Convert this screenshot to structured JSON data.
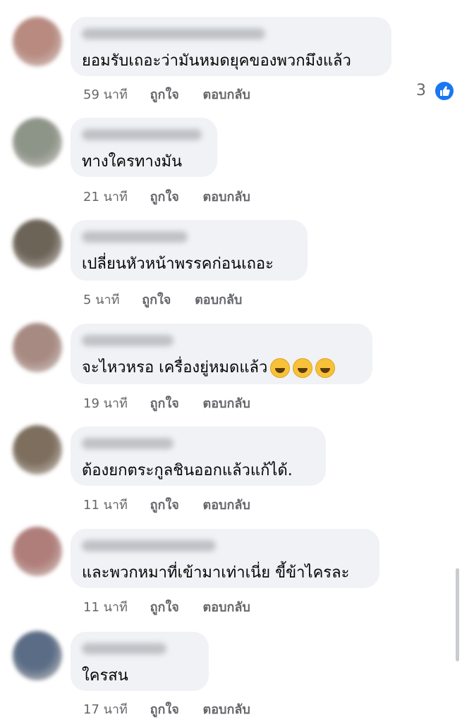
{
  "actions": {
    "like": "ถูกใจ",
    "reply": "ตอบกลับ"
  },
  "comments": [
    {
      "text": "ยอมรับเถอะว่ามันหมดยุคของพวกมึงแล้ว",
      "time": "59 นาที",
      "reaction_count": "3",
      "avatar_color": "#b88a80"
    },
    {
      "text": "ทางใครทางมัน",
      "time": "21 นาที",
      "avatar_color": "#8d9488"
    },
    {
      "text": "เปลี่ยนหัวหน้าพรรคก่อนเถอะ",
      "time": "5 นาที",
      "avatar_color": "#6d6458"
    },
    {
      "text": "จะไหวหรอ เครื่องยู่หมดแล้ว",
      "time": "19 นาที",
      "emojis": [
        "rofl-emoji",
        "rofl-emoji",
        "rofl-emoji"
      ],
      "avatar_color": "#a78a82"
    },
    {
      "text": "ต้องยกตระกูลชินออกแล้วแก้ได้.",
      "time": "11 นาที",
      "avatar_color": "#7d6e5e"
    },
    {
      "text": "และพวกหมาที่เข้ามาเท่าเนี่ย ขี้ข้าไครละ",
      "time": "11 นาที",
      "avatar_color": "#b07e7a"
    },
    {
      "text": "ใครสน",
      "time": "17 นาที",
      "avatar_color": "#5b6d86"
    }
  ]
}
